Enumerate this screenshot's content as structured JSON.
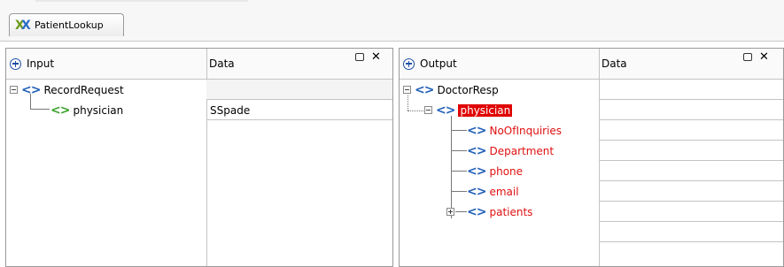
{
  "tab": {
    "label": "PatientLookup"
  },
  "input_panel": {
    "header": "Input",
    "data_header": "Data",
    "tree": [
      {
        "label": "RecordRequest",
        "value": ""
      },
      {
        "label": "physician",
        "value": "SSpade"
      }
    ]
  },
  "output_panel": {
    "header": "Output",
    "data_header": "Data",
    "tree": [
      {
        "label": "DoctorResp"
      },
      {
        "label": "physician"
      },
      {
        "label": "NoOfInquiries"
      },
      {
        "label": "Department"
      },
      {
        "label": "phone"
      },
      {
        "label": "email"
      },
      {
        "label": "patients"
      }
    ]
  },
  "tag_glyph": "<>",
  "maximize_glyph": "",
  "close_glyph": "✕"
}
